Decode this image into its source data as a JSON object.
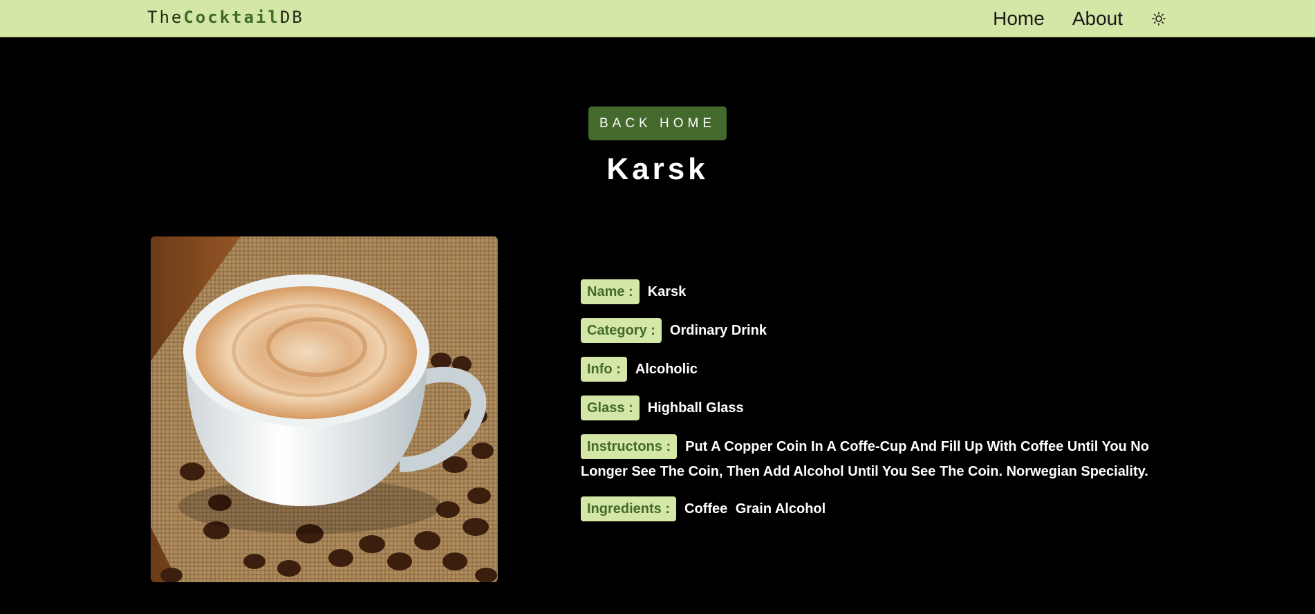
{
  "nav": {
    "logo_prefix": "The",
    "logo_strong": "Cocktail",
    "logo_suffix": "DB",
    "links": [
      "Home",
      "About"
    ],
    "theme_icon": "sun-icon"
  },
  "header": {
    "back_button": "BACK HOME",
    "title": "Karsk"
  },
  "drink": {
    "image_alt": "coffee cup with coffee beans",
    "fields": [
      {
        "label": "Name :",
        "value": "Karsk"
      },
      {
        "label": "Category :",
        "value": "Ordinary Drink"
      },
      {
        "label": "Info :",
        "value": "Alcoholic"
      },
      {
        "label": "Glass :",
        "value": "Highball Glass"
      },
      {
        "label": "Instructons :",
        "value": "Put A Copper Coin In A Coffe-Cup And Fill Up With Coffee Until You No Longer See The Coin, Then Add Alcohol Until You See The Coin. Norwegian Speciality."
      }
    ],
    "ingredients_label": "Ingredients :",
    "ingredients": [
      "Coffee",
      "Grain Alcohol"
    ]
  },
  "colors": {
    "nav_bg": "#d4e7a6",
    "accent": "#44692c",
    "page_bg": "#000000",
    "text": "#ffffff"
  }
}
